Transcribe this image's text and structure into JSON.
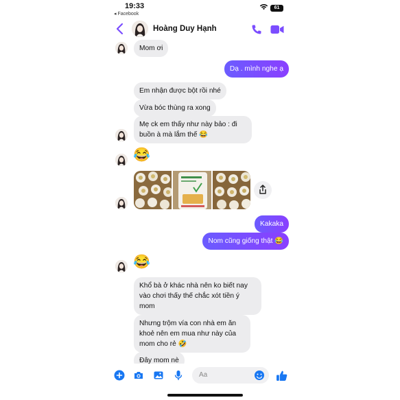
{
  "status_bar": {
    "time": "19:33",
    "back_app": "◂ Facebook",
    "battery": "61"
  },
  "header": {
    "contact_name": "Hoàng Duy Hạnh"
  },
  "messages": {
    "m1": "Mom ơi",
    "m2": "Dạ . mình nghe ạ",
    "m3": "Em nhận được bột rồi nhé",
    "m4": "Vừa bóc thùng ra xong",
    "m5_line1": "Mẹ ck em thấy như này bảo : đi",
    "m5_line2": "buồn à mà lắm thế 😂",
    "m6": "😂",
    "m7": "Kakaka",
    "m8": "Nom cũng giống thật 😂",
    "m9": "😂",
    "m10_line1": "Khổ bà ở khác nhà nên ko biết nay",
    "m10_line2": "vào chơi thấy thế chắc xót tiền ý",
    "m10_line3": "mom",
    "m11_line1": "Nhưng trộm vía con nhà em ăn",
    "m11_line2": "khoẻ nên em mua như này của",
    "m11_line3": "mom cho rẻ 🤣",
    "m12": "Đây mom nè"
  },
  "composer": {
    "placeholder": "Aa"
  },
  "colors": {
    "accent": "#7b4dff",
    "incoming_bubble": "#ececee",
    "icon_blue": "#1877f2"
  }
}
